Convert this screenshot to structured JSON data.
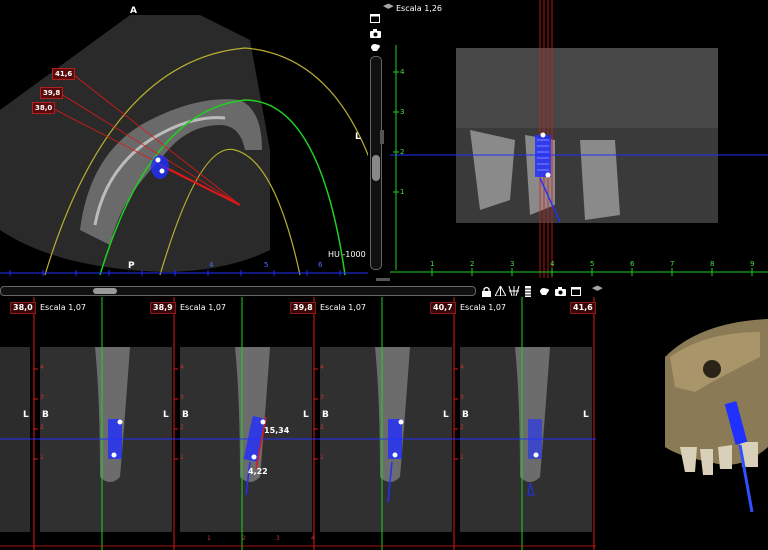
{
  "axial": {
    "title": "A",
    "label_p": "P",
    "label_l": "L",
    "hu": "HU -1000",
    "tags": [
      "41,6",
      "39,8",
      "38,0"
    ]
  },
  "coronal": {
    "scale": "Escala 1,26",
    "yticks": [
      "4",
      "3",
      "2",
      "1"
    ],
    "xticks": [
      "1",
      "2",
      "3",
      "4",
      "5",
      "6",
      "7",
      "8",
      "9"
    ]
  },
  "axial_ruler": {
    "ticks": [
      "4",
      "5",
      "6"
    ]
  },
  "sections": [
    {
      "pos": "38,0",
      "scale": "Escala 1,07",
      "left": "B",
      "right": "L"
    },
    {
      "pos": "38,9",
      "scale": "Escala 1,07",
      "left": "B",
      "right": "L"
    },
    {
      "pos": "39,8",
      "scale": "Escala 1,07",
      "left": "B",
      "right": "L"
    },
    {
      "pos": "40,7",
      "scale": "Escala 1,07",
      "left": "B",
      "right": "L"
    },
    {
      "pos": "41,6",
      "scale": "",
      "left": "",
      "right": "L"
    }
  ],
  "section_yticks": [
    "4",
    "3",
    "2",
    "1"
  ],
  "section_bottom_ticks": [
    "1",
    "2",
    "3",
    "4"
  ],
  "measurements": {
    "length": "15,34",
    "width": "4,22"
  },
  "toolbar_icons": [
    "lock-icon",
    "triangle-icon",
    "tooth-icon",
    "implant-icon",
    "hand-icon",
    "camera-icon",
    "window-icon"
  ],
  "colors": {
    "green": "#1fd01f",
    "blue": "#2030ff",
    "red": "#e01818",
    "yellow": "#b8b030"
  }
}
